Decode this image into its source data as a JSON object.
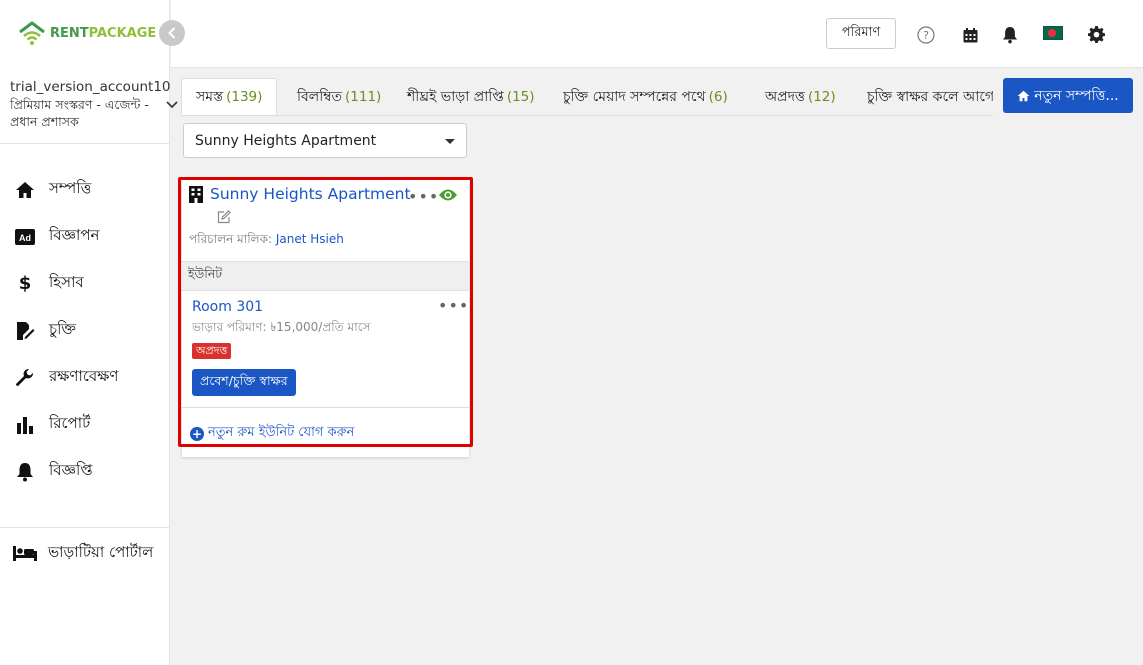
{
  "brand": {
    "rent": "RENT",
    "package": "PACKAGE",
    "primary_color": "#3f9a4a",
    "accent_color": "#1a56c4",
    "alert_color": "#d9322e"
  },
  "account": {
    "name": "trial_version_account10",
    "subtitle": "প্রিমিয়াম সংস্করণ - এজেন্ট - প্রধান প্রশাসক"
  },
  "sidebar": {
    "items": [
      {
        "label": "সম্পত্তি",
        "icon": "home-icon"
      },
      {
        "label": "বিজ্ঞাপন",
        "icon": "ad-icon"
      },
      {
        "label": "হিসাব",
        "icon": "dollar-icon"
      },
      {
        "label": "চুক্তি",
        "icon": "contract-icon"
      },
      {
        "label": "রক্ষণাবেক্ষণ",
        "icon": "wrench-icon"
      },
      {
        "label": "রিপোর্ট",
        "icon": "bar-chart-icon"
      },
      {
        "label": "বিজ্ঞপ্তি",
        "icon": "bell-icon"
      }
    ],
    "portal_label": "ভাড়াটিয়া পোর্টাল"
  },
  "header": {
    "measure_label": "পরিমাণ"
  },
  "tabs": [
    {
      "label": "সমস্ত",
      "count": "(139)"
    },
    {
      "label": "বিলম্বিত",
      "count": "(111)"
    },
    {
      "label": "শীঘ্রই ভাড়া প্রাপ্তি",
      "count": "(15)"
    },
    {
      "label": "চুক্তি মেয়াদ সম্পন্নের পথে",
      "count": "(6)"
    },
    {
      "label": "অপ্রদত্ত",
      "count": "(12)"
    },
    {
      "label": "চুক্তি স্বাক্ষর কলে আগে",
      "count": ""
    }
  ],
  "new_property_label": "নতুন সম্পত্তি...",
  "property_select": {
    "selected": "Sunny Heights Apartment"
  },
  "card": {
    "title": "Sunny Heights Apartment",
    "owner_label": "পরিচালন মালিক:",
    "owner_name": "Janet Hsieh",
    "units_header": "ইউনিট",
    "unit": {
      "name": "Room 301",
      "rent": "ভাড়ার পরিমাণ: ৳15,000/প্রতি মাসে",
      "status": "অপ্রদত্ত",
      "sign_label": "প্রবেশ/চুক্তি স্বাক্ষর"
    },
    "add_unit_label": "নতুন রুম ইউনিট যোগ করুন"
  }
}
